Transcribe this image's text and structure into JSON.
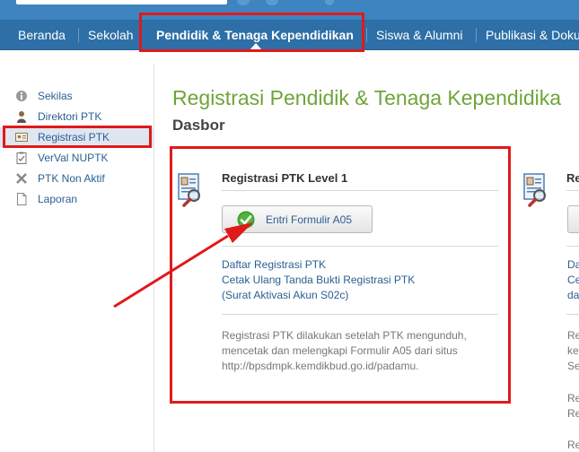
{
  "nav": {
    "items": [
      {
        "label": "Beranda"
      },
      {
        "label": "Sekolah"
      },
      {
        "label": "Pendidik & Tenaga Kependidikan"
      },
      {
        "label": "Siswa & Alumni"
      },
      {
        "label": "Publikasi & Doku"
      }
    ]
  },
  "sidebar": {
    "items": [
      {
        "label": "Sekilas",
        "icon": "info-icon"
      },
      {
        "label": "Direktori PTK",
        "icon": "person-icon"
      },
      {
        "label": "Registrasi PTK",
        "icon": "id-card-icon"
      },
      {
        "label": "VerVal NUPTK",
        "icon": "clipboard-icon"
      },
      {
        "label": "PTK Non Aktif",
        "icon": "x-icon"
      },
      {
        "label": "Laporan",
        "icon": "document-icon"
      }
    ]
  },
  "main": {
    "title": "Registrasi Pendidik & Tenaga Kependidika",
    "subtitle": "Dasbor"
  },
  "card1": {
    "title": "Registrasi PTK Level 1",
    "button_label": "Entri Formulir A05",
    "links": [
      "Daftar Registrasi PTK",
      "Cetak Ulang Tanda Bukti Registrasi PTK",
      "(Surat Aktivasi Akun S02c)"
    ],
    "note_lines": [
      "Registrasi PTK dilakukan setelah PTK mengunduh,",
      "mencetak dan melengkapi Formulir A05 dari situs",
      "http://bpsdmpk.kemdikbud.go.id/padamu."
    ]
  },
  "card2": {
    "title_fragment": "Re",
    "link_fragments": [
      "Da",
      "Ce",
      "da"
    ],
    "note_fragments": [
      "Re",
      "ke",
      "Se",
      "Re",
      "Re",
      "Re"
    ]
  },
  "colors": {
    "nav_bg": "#2d6fa6",
    "title_green": "#6fa43a",
    "link_blue": "#2a5f93",
    "annotation_red": "#e0191b"
  }
}
